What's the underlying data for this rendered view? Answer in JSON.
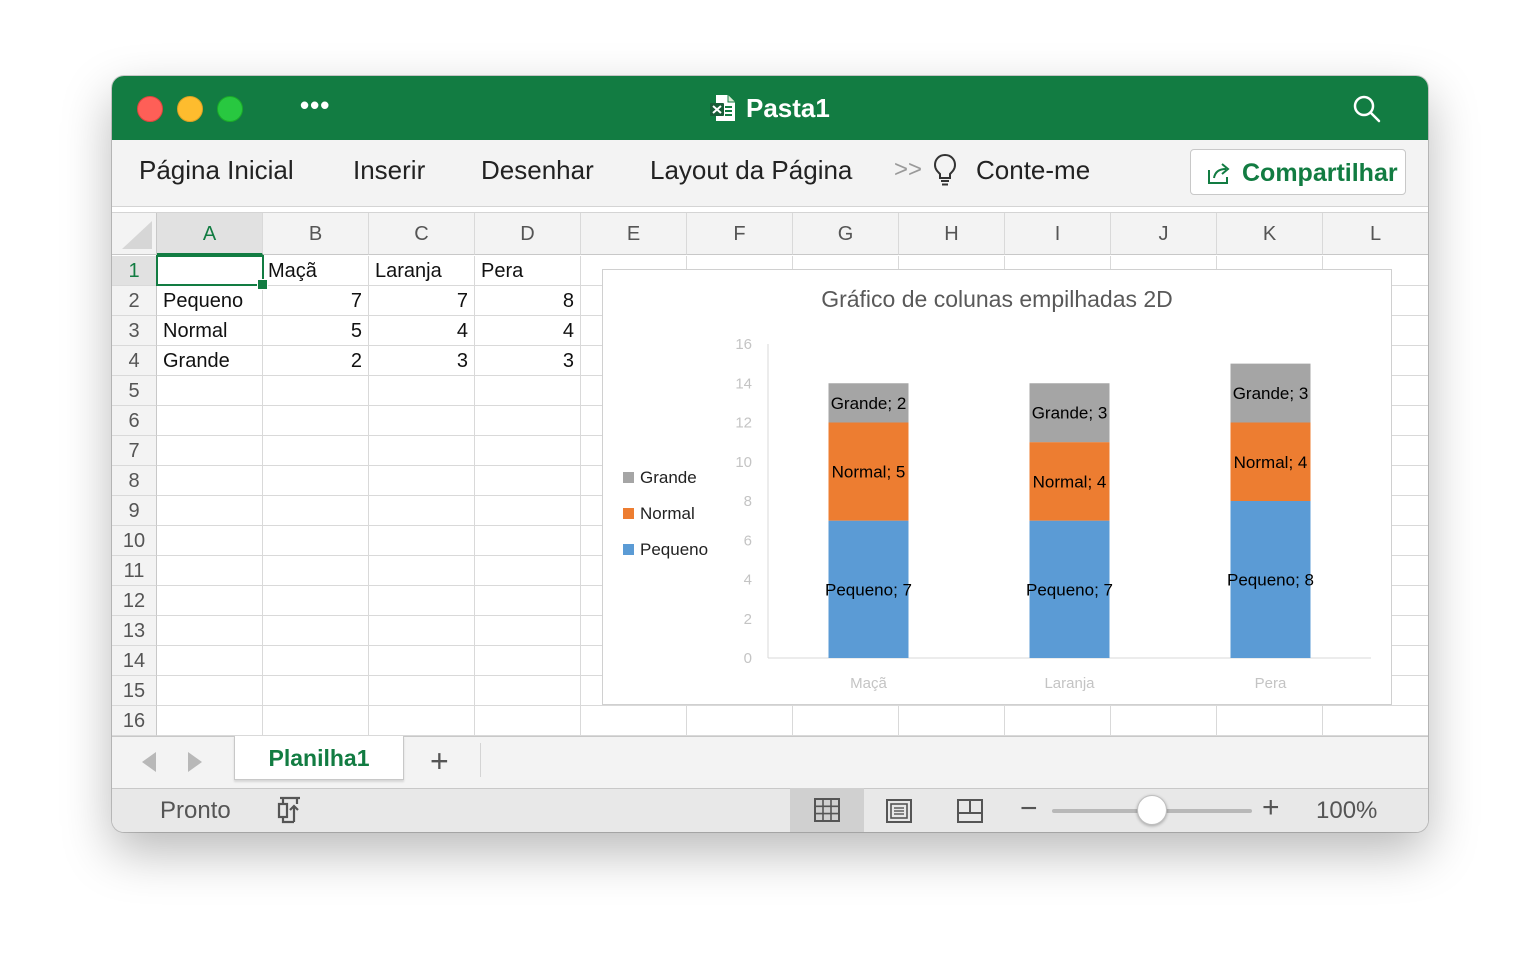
{
  "window": {
    "title": "Pasta1"
  },
  "ribbon": {
    "tabs": [
      "Página Inicial",
      "Inserir",
      "Desenhar",
      "Layout da Página"
    ],
    "overflow_icon": "chevron-double-right-icon",
    "tell_me": "Conte-me",
    "share_label": "Compartilhar"
  },
  "sheet": {
    "columns": [
      "A",
      "B",
      "C",
      "D",
      "E",
      "F",
      "G",
      "H",
      "I",
      "J",
      "K",
      "L"
    ],
    "rows": [
      "1",
      "2",
      "3",
      "4",
      "5",
      "6",
      "7",
      "8",
      "9",
      "10",
      "11",
      "12",
      "13",
      "14",
      "15",
      "16"
    ],
    "selected_cell": "A1",
    "cells": [
      [
        "",
        "Maçã",
        "Laranja",
        "Pera"
      ],
      [
        "Pequeno",
        "7",
        "7",
        "8"
      ],
      [
        "Normal",
        "5",
        "4",
        "4"
      ],
      [
        "Grande",
        "2",
        "3",
        "3"
      ]
    ]
  },
  "chart_data": {
    "type": "bar",
    "stacked": true,
    "title": "Gráfico de colunas empilhadas 2D",
    "categories": [
      "Maçã",
      "Laranja",
      "Pera"
    ],
    "series": [
      {
        "name": "Pequeno",
        "values": [
          7,
          7,
          8
        ],
        "color": "#5b9bd5"
      },
      {
        "name": "Normal",
        "values": [
          5,
          4,
          4
        ],
        "color": "#ed7d31"
      },
      {
        "name": "Grande",
        "values": [
          2,
          3,
          3
        ],
        "color": "#a5a5a5"
      }
    ],
    "yticks": [
      "0",
      "2",
      "4",
      "6",
      "8",
      "10",
      "12",
      "14",
      "16"
    ],
    "ylim": [
      0,
      16
    ],
    "xlabel": "",
    "ylabel": "",
    "legend_position": "left",
    "data_labels": true,
    "grid": false
  },
  "sheet_tabs": {
    "active": "Planilha1",
    "add_label": "+"
  },
  "status": {
    "text": "Pronto",
    "zoom_minus": "−",
    "zoom_plus": "+",
    "zoom": "100%",
    "zoom_fraction": 0.5
  }
}
